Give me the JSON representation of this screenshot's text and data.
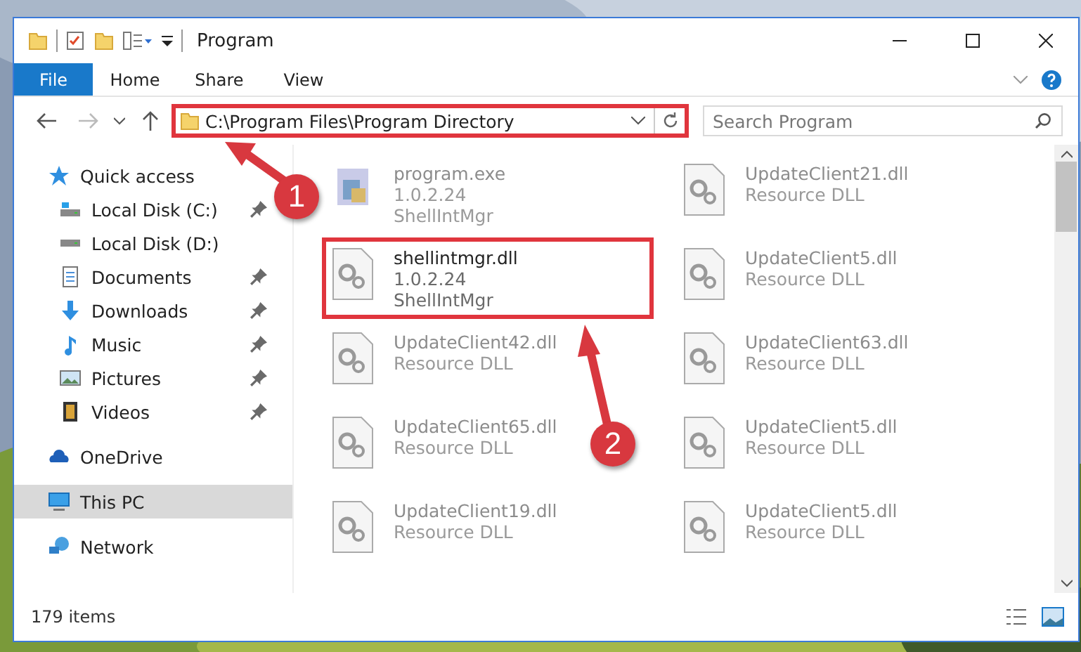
{
  "window": {
    "title": "Program"
  },
  "ribbon_tabs": [
    {
      "label": "File",
      "kind": "menu"
    },
    {
      "label": "Home",
      "kind": "tab"
    },
    {
      "label": "Share",
      "kind": "tab"
    },
    {
      "label": "View",
      "kind": "tab"
    }
  ],
  "address": {
    "path": "C:\\Program Files\\Program Directory",
    "highlighted": true
  },
  "search": {
    "placeholder": "Search Program"
  },
  "sidebar": {
    "items": [
      {
        "label": "Quick access",
        "selected": false,
        "children": [
          {
            "label": "Local Disk (C:)",
            "pinned": true
          },
          {
            "label": "Local Disk (D:)",
            "pinned": false
          },
          {
            "label": "Documents",
            "pinned": true
          },
          {
            "label": "Downloads",
            "pinned": true
          },
          {
            "label": "Music",
            "pinned": true
          },
          {
            "label": "Pictures",
            "pinned": true
          },
          {
            "label": "Videos",
            "pinned": true
          }
        ]
      },
      {
        "label": "OneDrive",
        "selected": false
      },
      {
        "label": "This PC",
        "selected": true
      },
      {
        "label": "Network",
        "selected": false
      }
    ]
  },
  "files": [
    {
      "name": "program.exe",
      "details": [
        "1.0.2.24",
        "ShellIntMgr"
      ],
      "kind": "exe",
      "highlighted": false,
      "blurred": true
    },
    {
      "name": "UpdateClient21.dll",
      "details": [
        "Resource DLL"
      ],
      "kind": "dll",
      "highlighted": false,
      "blurred": true
    },
    {
      "name": "shellintmgr.dll",
      "details": [
        "1.0.2.24",
        "ShellIntMgr"
      ],
      "kind": "dll",
      "highlighted": true,
      "blurred": false
    },
    {
      "name": "UpdateClient5.dll",
      "details": [
        "Resource DLL"
      ],
      "kind": "dll",
      "highlighted": false,
      "blurred": true
    },
    {
      "name": "UpdateClient42.dll",
      "details": [
        "Resource DLL"
      ],
      "kind": "dll",
      "highlighted": false,
      "blurred": true
    },
    {
      "name": "UpdateClient63.dll",
      "details": [
        "Resource DLL"
      ],
      "kind": "dll",
      "highlighted": false,
      "blurred": true
    },
    {
      "name": "UpdateClient65.dll",
      "details": [
        "Resource DLL"
      ],
      "kind": "dll",
      "highlighted": false,
      "blurred": true
    },
    {
      "name": "UpdateClient5.dll",
      "details": [
        "Resource DLL"
      ],
      "kind": "dll",
      "highlighted": false,
      "blurred": true
    },
    {
      "name": "UpdateClient19.dll",
      "details": [
        "Resource DLL"
      ],
      "kind": "dll",
      "highlighted": false,
      "blurred": true
    },
    {
      "name": "UpdateClient5.dll",
      "details": [
        "Resource DLL"
      ],
      "kind": "dll",
      "highlighted": false,
      "blurred": true
    }
  ],
  "status_bar": {
    "count": "179 items"
  },
  "annotations": [
    {
      "number": "1"
    },
    {
      "number": "2"
    }
  ]
}
